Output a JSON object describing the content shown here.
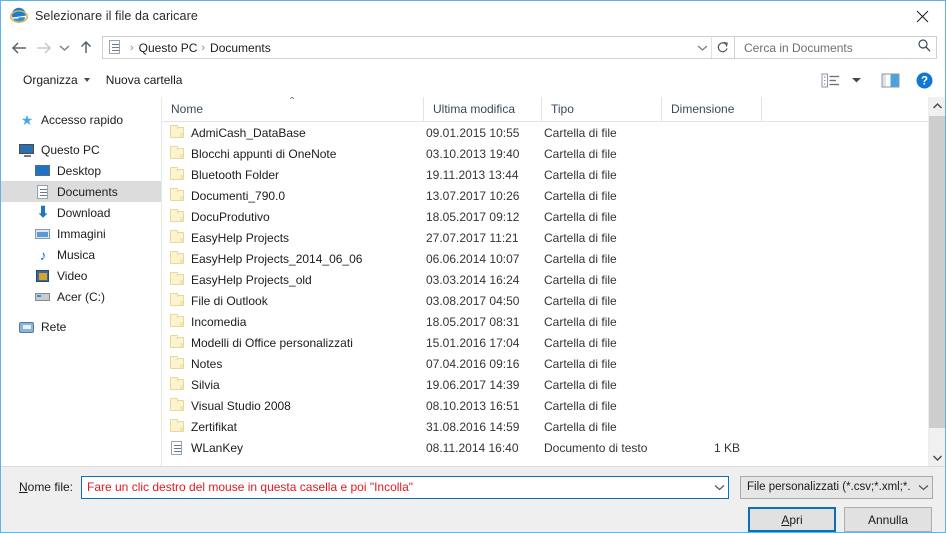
{
  "window": {
    "title": "Selezionare il file da caricare",
    "title_icon": "internet-explorer-icon",
    "close_label": "✕",
    "border_color": "#5eb4e3"
  },
  "navigation": {
    "back_title": "Indietro",
    "forward_title": "Avanti",
    "recent_title": "Percorsi recenti",
    "up_title": "Su",
    "breadcrumb": {
      "icon": "documents-folder-icon",
      "separator": "›",
      "items": [
        "Questo PC",
        "Documents"
      ]
    },
    "dropdown_glyph": "⌄",
    "refresh_glyph": "↻"
  },
  "search": {
    "placeholder": "Cerca in Documents",
    "value": "",
    "icon": "search-icon"
  },
  "toolbar": {
    "organize_label": "Organizza",
    "new_folder_label": "Nuova cartella",
    "view_icon": "view-options-icon",
    "view_caret": "▾",
    "preview_pane_icon": "preview-pane-icon",
    "help_icon": "help-icon",
    "help_glyph": "?",
    "help_color": "#1177d1"
  },
  "sidebar": {
    "items": [
      {
        "label": "Accesso rapido",
        "icon": "star-icon",
        "level": 1,
        "selected": false
      },
      {
        "label": "Questo PC",
        "icon": "monitor-icon",
        "level": 1,
        "selected": false
      },
      {
        "label": "Desktop",
        "icon": "desktop-icon",
        "level": 2,
        "selected": false
      },
      {
        "label": "Documents",
        "icon": "documents-folder-icon",
        "level": 2,
        "selected": true
      },
      {
        "label": "Download",
        "icon": "download-arrow-icon",
        "level": 2,
        "selected": false
      },
      {
        "label": "Immagini",
        "icon": "pictures-icon",
        "level": 2,
        "selected": false
      },
      {
        "label": "Musica",
        "icon": "music-note-icon",
        "level": 2,
        "selected": false
      },
      {
        "label": "Video",
        "icon": "video-icon",
        "level": 2,
        "selected": false
      },
      {
        "label": "Acer (C:)",
        "icon": "hard-drive-icon",
        "level": 2,
        "selected": false
      },
      {
        "label": "Rete",
        "icon": "network-icon",
        "level": 1,
        "selected": false
      }
    ]
  },
  "file_list": {
    "columns": [
      {
        "label": "Nome",
        "sorted": "asc",
        "sort_glyph": "⌃"
      },
      {
        "label": "Ultima modifica",
        "sorted": ""
      },
      {
        "label": "Tipo",
        "sorted": ""
      },
      {
        "label": "Dimensione",
        "sorted": ""
      }
    ],
    "rows": [
      {
        "name": "AdmiCash_DataBase",
        "modified": "09.01.2015 10:55",
        "type": "Cartella di file",
        "size": "",
        "icon": "folder-icon"
      },
      {
        "name": "Blocchi appunti di OneNote",
        "modified": "03.10.2013 19:40",
        "type": "Cartella di file",
        "size": "",
        "icon": "folder-icon"
      },
      {
        "name": "Bluetooth Folder",
        "modified": "19.11.2013 13:44",
        "type": "Cartella di file",
        "size": "",
        "icon": "folder-icon"
      },
      {
        "name": "Documenti_790.0",
        "modified": "13.07.2017 10:26",
        "type": "Cartella di file",
        "size": "",
        "icon": "folder-icon"
      },
      {
        "name": "DocuProdutivo",
        "modified": "18.05.2017 09:12",
        "type": "Cartella di file",
        "size": "",
        "icon": "folder-icon"
      },
      {
        "name": "EasyHelp Projects",
        "modified": "27.07.2017 11:21",
        "type": "Cartella di file",
        "size": "",
        "icon": "folder-icon"
      },
      {
        "name": "EasyHelp Projects_2014_06_06",
        "modified": "06.06.2014 10:07",
        "type": "Cartella di file",
        "size": "",
        "icon": "folder-icon"
      },
      {
        "name": "EasyHelp Projects_old",
        "modified": "03.03.2014 16:24",
        "type": "Cartella di file",
        "size": "",
        "icon": "folder-icon"
      },
      {
        "name": "File di Outlook",
        "modified": "03.08.2017 04:50",
        "type": "Cartella di file",
        "size": "",
        "icon": "folder-icon"
      },
      {
        "name": "Incomedia",
        "modified": "18.05.2017 08:31",
        "type": "Cartella di file",
        "size": "",
        "icon": "folder-icon"
      },
      {
        "name": "Modelli di Office personalizzati",
        "modified": "15.01.2016 17:04",
        "type": "Cartella di file",
        "size": "",
        "icon": "folder-icon"
      },
      {
        "name": "Notes",
        "modified": "07.04.2016 09:16",
        "type": "Cartella di file",
        "size": "",
        "icon": "folder-icon"
      },
      {
        "name": "Silvia",
        "modified": "19.06.2017 14:39",
        "type": "Cartella di file",
        "size": "",
        "icon": "folder-icon"
      },
      {
        "name": "Visual Studio 2008",
        "modified": "08.10.2013 16:51",
        "type": "Cartella di file",
        "size": "",
        "icon": "folder-icon"
      },
      {
        "name": "Zertifikat",
        "modified": "31.08.2016 14:59",
        "type": "Cartella di file",
        "size": "",
        "icon": "folder-icon"
      },
      {
        "name": "WLanKey",
        "modified": "08.11.2014 16:40",
        "type": "Documento di testo",
        "size": "1 KB",
        "icon": "text-document-icon"
      }
    ],
    "scrollbar": {
      "up_glyph": "⌃",
      "down_glyph": "⌄"
    }
  },
  "footer": {
    "filename_label_pre": "N",
    "filename_label_post": "ome file:",
    "filename_value": "Fare un clic destro del mouse in questa casella e poi \"Incolla\"",
    "filename_value_color": "#e01b20",
    "filename_dropdown_glyph": "⌄",
    "filetype_value": "File personalizzati (*.csv;*.xml;*.",
    "filetype_dropdown_glyph": "⌄",
    "open_label_pre": "A",
    "open_label_post": "pri",
    "cancel_label": "Annulla",
    "focus_color": "#0d6fb8"
  }
}
